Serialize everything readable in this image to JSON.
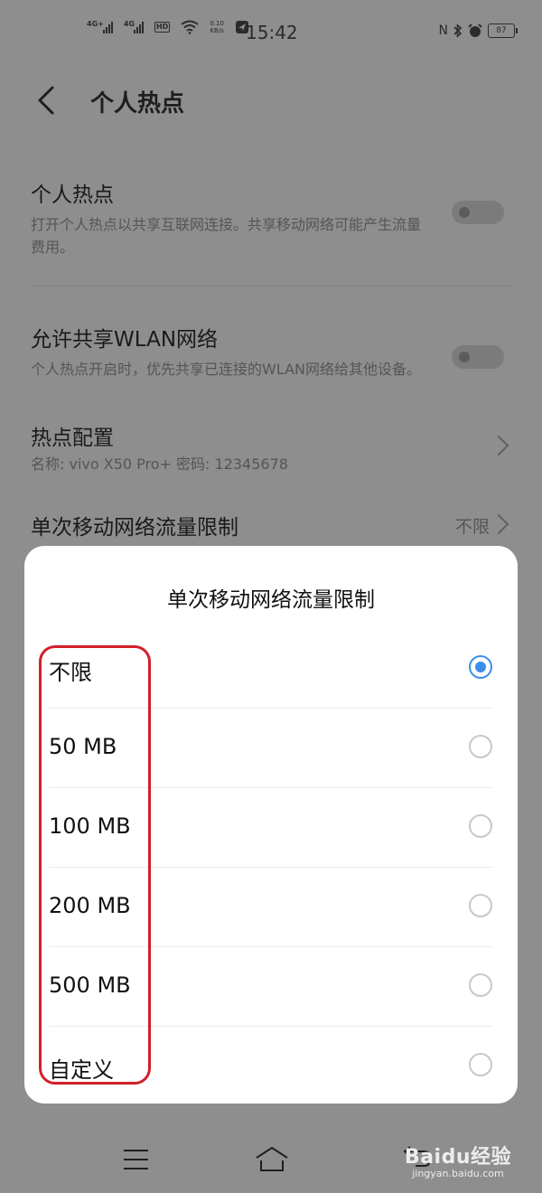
{
  "status_bar": {
    "net1": "4G+",
    "net2": "4G",
    "hd": "HD",
    "speed_value": "0.10",
    "speed_unit": "KB/s",
    "time": "15:42",
    "battery": "87"
  },
  "header": {
    "title": "个人热点"
  },
  "settings": {
    "hotspot": {
      "title": "个人热点",
      "desc": "打开个人热点以共享互联网连接。共享移动网络可能产生流量费用。"
    },
    "share_wlan": {
      "title": "允许共享WLAN网络",
      "desc": "个人热点开启时，优先共享已连接的WLAN网络给其他设备。"
    },
    "hotspot_config": {
      "title": "热点配置",
      "desc": "名称: vivo X50 Pro+  密码: 12345678"
    },
    "data_limit": {
      "title": "单次移动网络流量限制",
      "value": "不限"
    }
  },
  "dialog": {
    "title": "单次移动网络流量限制",
    "options": [
      {
        "label": "不限",
        "selected": true
      },
      {
        "label": "50 MB",
        "selected": false
      },
      {
        "label": "100 MB",
        "selected": false
      },
      {
        "label": "200 MB",
        "selected": false
      },
      {
        "label": "500 MB",
        "selected": false
      },
      {
        "label": "自定义",
        "selected": false
      }
    ]
  },
  "watermark": {
    "logo": "Baidu经验",
    "sub": "jingyan.baidu.com"
  },
  "colors": {
    "accent": "#3a8fea",
    "highlight": "#d21f2a",
    "overlay": "#8e8e8e"
  }
}
